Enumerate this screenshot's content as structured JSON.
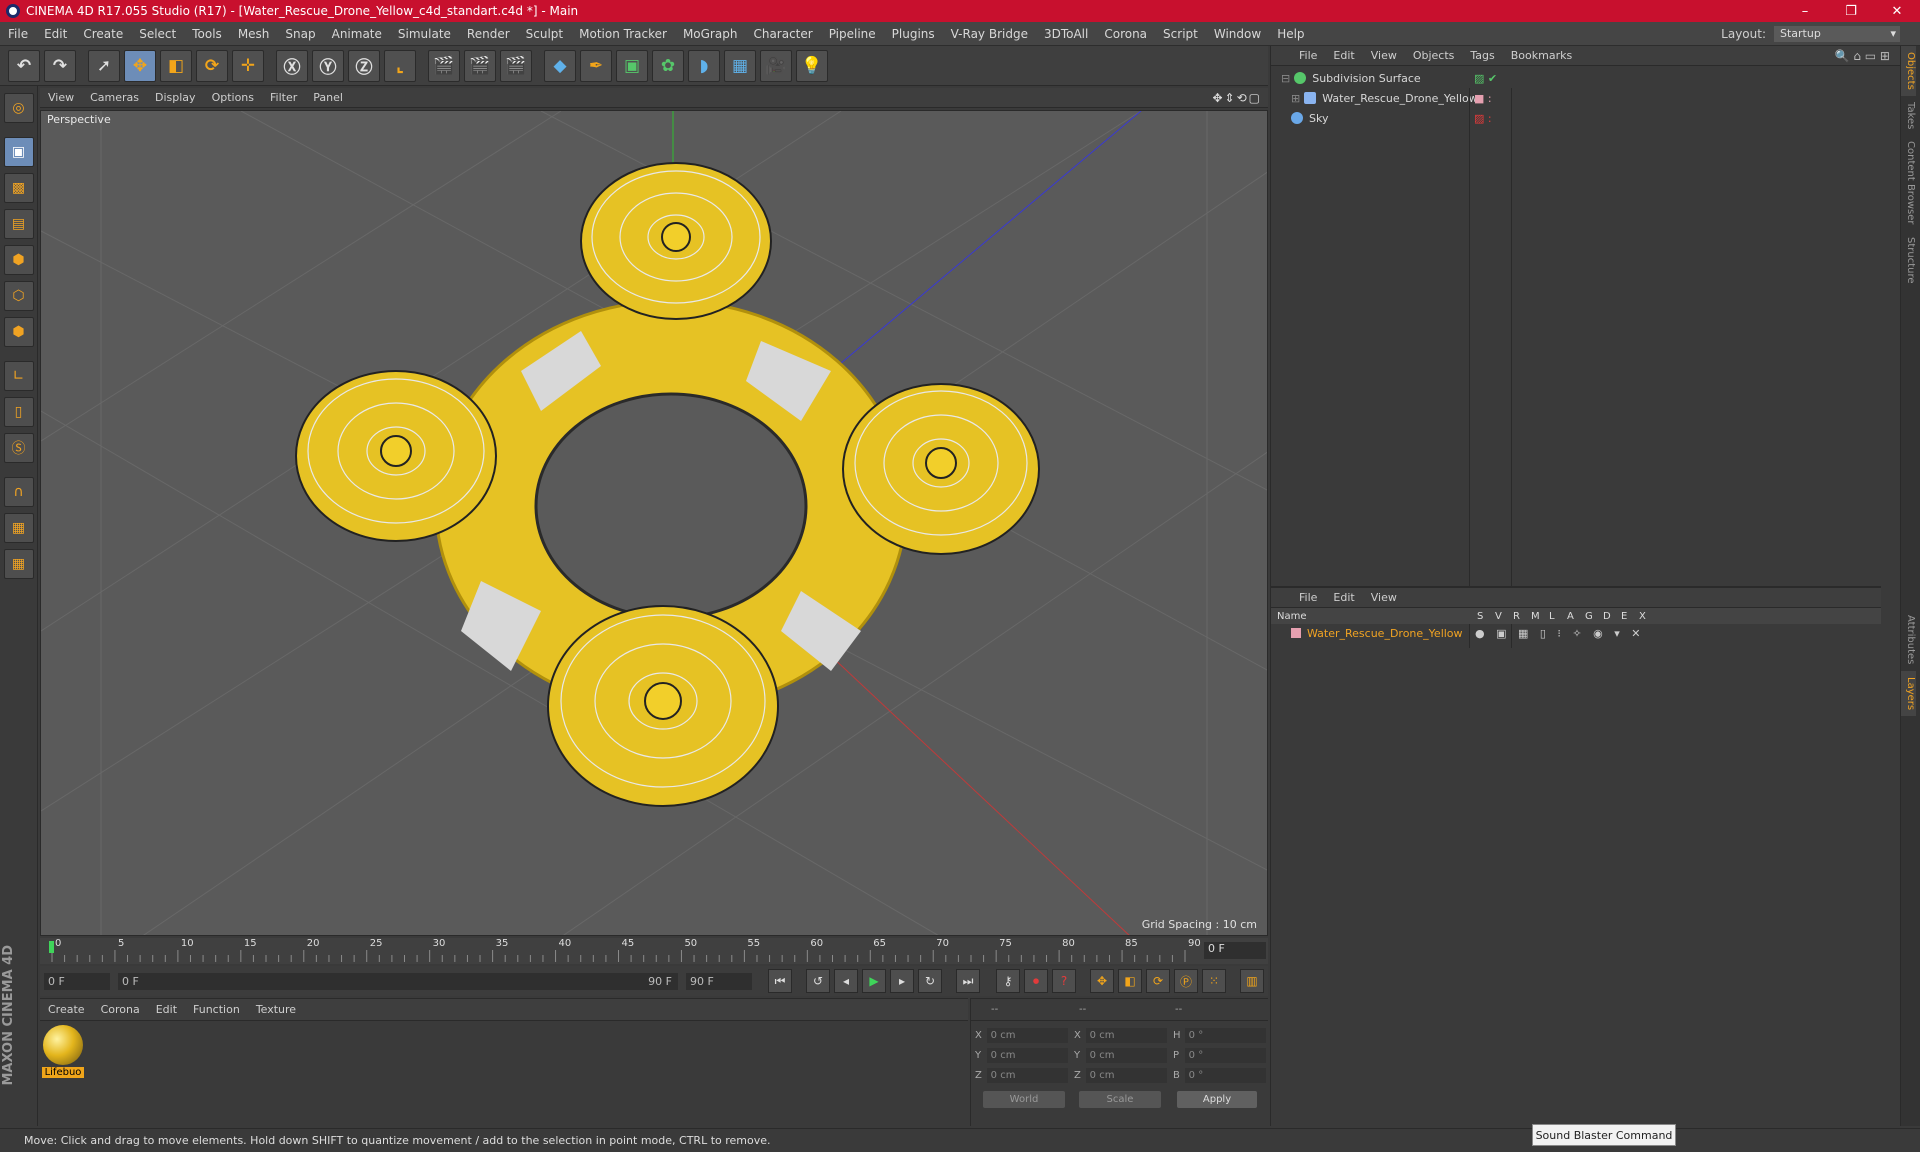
{
  "titlebar": {
    "title": "CINEMA 4D R17.055 Studio (R17) - [Water_Rescue_Drone_Yellow_c4d_standart.c4d *] - Main",
    "min": "–",
    "max": "❐",
    "close": "✕"
  },
  "menu": [
    "File",
    "Edit",
    "Create",
    "Select",
    "Tools",
    "Mesh",
    "Snap",
    "Animate",
    "Simulate",
    "Render",
    "Sculpt",
    "Motion Tracker",
    "MoGraph",
    "Character",
    "Pipeline",
    "Plugins",
    "V-Ray Bridge",
    "3DToAll",
    "Corona",
    "Script",
    "Window",
    "Help"
  ],
  "layout": {
    "label": "Layout:",
    "value": "Startup"
  },
  "viewport": {
    "menu": [
      "View",
      "Cameras",
      "Display",
      "Options",
      "Filter",
      "Panel"
    ],
    "label": "Perspective",
    "grid_spacing": "Grid Spacing : 10 cm"
  },
  "timeline": {
    "ticks": [
      "0",
      "5",
      "10",
      "15",
      "20",
      "25",
      "30",
      "35",
      "40",
      "45",
      "50",
      "55",
      "60",
      "65",
      "70",
      "75",
      "80",
      "85",
      "90"
    ],
    "frame": "0 F"
  },
  "playbar": {
    "start": "0 F",
    "slider_start": "0 F",
    "slider_end": "90 F",
    "end": "90 F"
  },
  "material": {
    "menu": [
      "Create",
      "Corona",
      "Edit",
      "Function",
      "Texture"
    ],
    "name": "Lifebuo"
  },
  "coords": {
    "headers": [
      "--",
      "--",
      "--"
    ],
    "rows": [
      {
        "a": "X",
        "v1": "0 cm",
        "b": "X",
        "v2": "0 cm",
        "c": "H",
        "v3": "0 °"
      },
      {
        "a": "Y",
        "v1": "0 cm",
        "b": "Y",
        "v2": "0 cm",
        "c": "P",
        "v3": "0 °"
      },
      {
        "a": "Z",
        "v1": "0 cm",
        "b": "Z",
        "v2": "0 cm",
        "c": "B",
        "v3": "0 °"
      }
    ],
    "world": "World",
    "scale": "Scale",
    "apply": "Apply"
  },
  "objects": {
    "menu": [
      "File",
      "Edit",
      "View",
      "Objects",
      "Tags",
      "Bookmarks"
    ],
    "items": [
      "Subdivision Surface",
      "Water_Rescue_Drone_Yellow",
      "Sky"
    ]
  },
  "layers": {
    "menu": [
      "File",
      "Edit",
      "View"
    ],
    "name_header": "Name",
    "cols": [
      "S",
      "V",
      "R",
      "M",
      "L",
      "A",
      "G",
      "D",
      "E",
      "X"
    ],
    "items": [
      "Water_Rescue_Drone_Yellow"
    ]
  },
  "side_tabs": [
    "Objects",
    "Takes",
    "Content Browser",
    "Structure",
    "Attributes",
    "Layers"
  ],
  "status": "Move: Click and drag to move elements. Hold down SHIFT to quantize movement / add to the selection in point mode, CTRL to remove.",
  "tooltip": "Sound Blaster Command",
  "brand": "MAXON CINEMA 4D",
  "colors": {
    "accent": "#f0a323",
    "title": "#c8102e",
    "selection": "#6d8db8"
  }
}
